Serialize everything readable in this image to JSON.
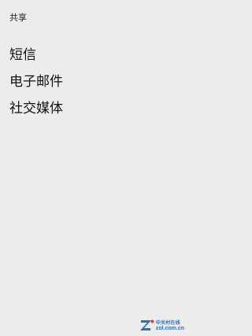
{
  "share_panel": {
    "title": "共享",
    "items": [
      {
        "label": "短信"
      },
      {
        "label": "电子邮件"
      },
      {
        "label": "社交媒体"
      }
    ]
  },
  "watermark": {
    "logo_icon": "zol-logo-icon",
    "text_cn": "中关村在线",
    "text_en": "zol.com.cn",
    "color": "#2f6fb6"
  }
}
